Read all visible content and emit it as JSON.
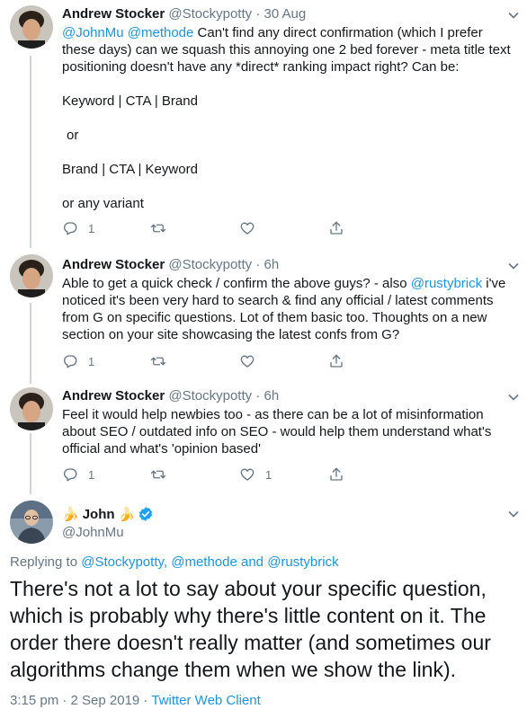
{
  "tweets": [
    {
      "name": "Andrew Stocker",
      "handle": "@Stockypotty",
      "sep": "·",
      "time": "30 Aug",
      "mention1": "@JohnMu",
      "mention2": "@methode",
      "line1_rest": "Can't find any direct confirmation (which I prefer these days) can we squash this annoying one 2 bed forever - meta title text positioning doesn't have any *direct* ranking impact right? Can be:",
      "p2": "Keyword | CTA | Brand",
      "p3": "or",
      "p4": "Brand | CTA | Keyword",
      "p5": "or any variant",
      "reply_count": "1",
      "retweet_count": "",
      "like_count": ""
    },
    {
      "name": "Andrew Stocker",
      "handle": "@Stockypotty",
      "sep": "·",
      "time": "6h",
      "before": "Able to get a quick check / confirm the above guys? - also ",
      "mention": "@rustybrick",
      "after": " i've noticed it's been very hard to search & find any official / latest comments from G on specific questions. Lot of them basic too. Thoughts on a new section on your site showcasing the latest confs from G?",
      "reply_count": "1",
      "retweet_count": "",
      "like_count": ""
    },
    {
      "name": "Andrew Stocker",
      "handle": "@Stockypotty",
      "sep": "·",
      "time": "6h",
      "text": "Feel it would help newbies too - as there can be a lot of misinformation about SEO / outdated info on SEO - would help them understand what's official and what's 'opinion based'",
      "reply_count": "1",
      "retweet_count": "",
      "like_count": "1"
    }
  ],
  "main": {
    "name_prefix_emoji": "🍌",
    "name": "John",
    "name_suffix_emoji": "🍌",
    "handle": "@JohnMu",
    "replying_label": "Replying to",
    "replying_m1": "@Stockypotty,",
    "replying_m2": "@methode",
    "replying_and": "and",
    "replying_m3": "@rustybrick",
    "text": "There's not a lot to say about your specific question, which is probably why there's little content on it. The order there doesn't really matter (and sometimes our algorithms change them when we show the link).",
    "timestamp": "3:15 pm · 2 Sep 2019 ·",
    "client": "Twitter Web Client"
  },
  "colors": {
    "link": "#1b95e0",
    "muted": "#657786",
    "verified": "#1da1f2",
    "thread": "#ccd6dd"
  },
  "icons": [
    "reply-icon",
    "retweet-icon",
    "like-icon",
    "share-icon",
    "chevron-down-icon",
    "verified-badge-icon"
  ]
}
